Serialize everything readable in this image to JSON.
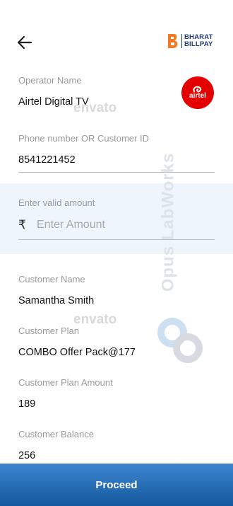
{
  "header": {
    "back_icon": "arrow-left-icon",
    "biller_brand": {
      "line1": "BHARAT",
      "line2": "BILLPAY"
    }
  },
  "operator": {
    "label": "Operator Name",
    "value": "Airtel Digital TV",
    "logo_text": "airtel",
    "logo_color": "#e40000"
  },
  "phone": {
    "label": "Phone number OR Customer ID",
    "value": "8541221452"
  },
  "amount": {
    "label": "Enter valid amount",
    "currency_symbol": "₹",
    "placeholder": "Enter Amount",
    "value": ""
  },
  "customer": {
    "name_label": "Customer Name",
    "name_value": "Samantha Smith",
    "plan_label": "Customer Plan",
    "plan_value": "COMBO Offer Pack@177",
    "plan_amount_label": "Customer Plan Amount",
    "plan_amount_value": "189",
    "balance_label": "Customer Balance",
    "balance_value": "256"
  },
  "watermarks": {
    "envato": "envato",
    "opus": "Opus LabWorks"
  },
  "actions": {
    "proceed_label": "Proceed"
  },
  "colors": {
    "accent_gradient_top": "#3c86cf",
    "accent_gradient_bottom": "#15599f",
    "amount_band": "#eef5fb"
  }
}
